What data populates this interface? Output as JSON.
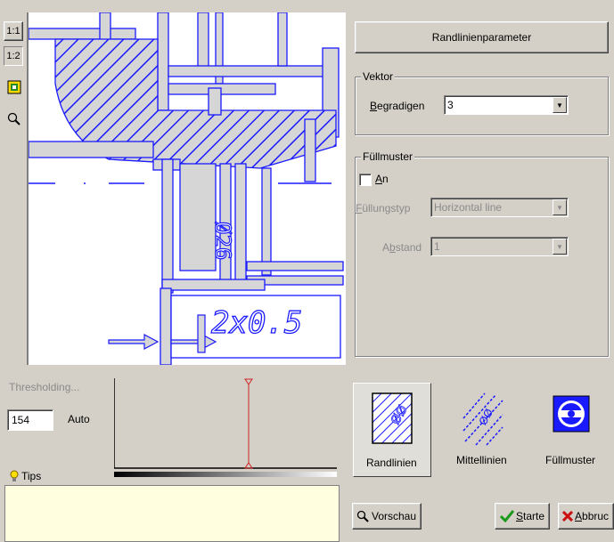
{
  "toolbar": {
    "zoom_1_1": "1:1",
    "zoom_1_2": "1:2"
  },
  "drawing": {
    "dim_label": "Ø26",
    "dim_label2": "2x0.5"
  },
  "panel": {
    "header_button": "Randlinienparameter",
    "vektor": {
      "title": "Vektor",
      "begradigen_label_u": "B",
      "begradigen_label_rest": "egradigen",
      "begradigen_value": "3"
    },
    "fuellmuster": {
      "title": "Füllmuster",
      "an_label_u": "A",
      "an_label_rest": "n",
      "an_checked": false,
      "fuellungstyp_label_u": "F",
      "fuellungstyp_label_rest": "üllungstyp",
      "fuellungstyp_value": "Horizontal line",
      "abstand_label_pre": "A",
      "abstand_label_u": "b",
      "abstand_label_rest": "stand",
      "abstand_value": "1"
    }
  },
  "threshold": {
    "label": "Thresholding...",
    "value": "154",
    "auto_label": "Auto",
    "marker_value": 154,
    "max_value": 255
  },
  "tips": {
    "label": "Tips"
  },
  "modes": {
    "randlinien": "Randlinien",
    "mittellinien": "Mittellinien",
    "fuellmuster": "Füllmuster"
  },
  "actions": {
    "vorschau": "Vorschau",
    "starte_u": "S",
    "starte_rest": "tarte",
    "abbruch_u": "A",
    "abbruch_rest": "bbruc"
  },
  "colors": {
    "accent_blue": "#1a1aff",
    "drawing_gray": "#d6d6d6",
    "tips_bg": "#ffffe0",
    "marker_red": "#cc2222"
  }
}
